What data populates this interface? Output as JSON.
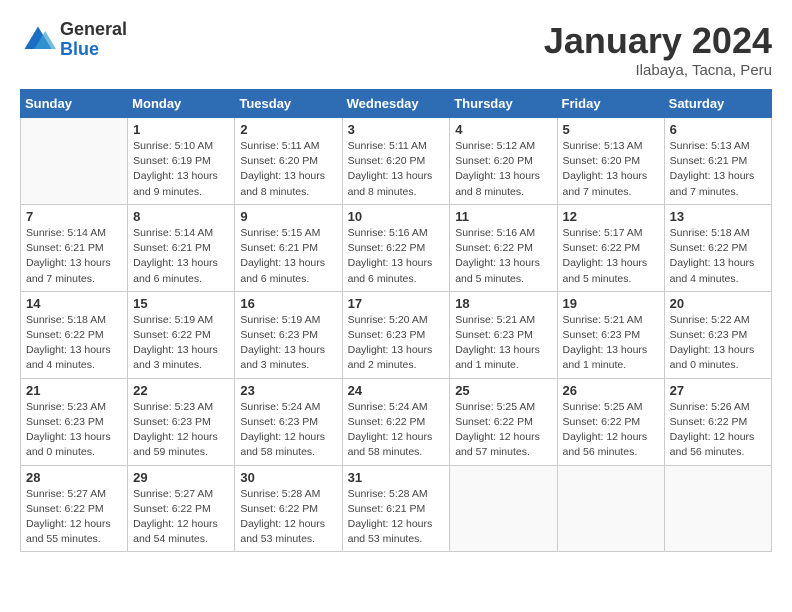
{
  "logo": {
    "general": "General",
    "blue": "Blue"
  },
  "header": {
    "month": "January 2024",
    "location": "Ilabaya, Tacna, Peru"
  },
  "days_of_week": [
    "Sunday",
    "Monday",
    "Tuesday",
    "Wednesday",
    "Thursday",
    "Friday",
    "Saturday"
  ],
  "weeks": [
    [
      {
        "day": "",
        "info": ""
      },
      {
        "day": "1",
        "info": "Sunrise: 5:10 AM\nSunset: 6:19 PM\nDaylight: 13 hours\nand 9 minutes."
      },
      {
        "day": "2",
        "info": "Sunrise: 5:11 AM\nSunset: 6:20 PM\nDaylight: 13 hours\nand 8 minutes."
      },
      {
        "day": "3",
        "info": "Sunrise: 5:11 AM\nSunset: 6:20 PM\nDaylight: 13 hours\nand 8 minutes."
      },
      {
        "day": "4",
        "info": "Sunrise: 5:12 AM\nSunset: 6:20 PM\nDaylight: 13 hours\nand 8 minutes."
      },
      {
        "day": "5",
        "info": "Sunrise: 5:13 AM\nSunset: 6:20 PM\nDaylight: 13 hours\nand 7 minutes."
      },
      {
        "day": "6",
        "info": "Sunrise: 5:13 AM\nSunset: 6:21 PM\nDaylight: 13 hours\nand 7 minutes."
      }
    ],
    [
      {
        "day": "7",
        "info": "Sunrise: 5:14 AM\nSunset: 6:21 PM\nDaylight: 13 hours\nand 7 minutes."
      },
      {
        "day": "8",
        "info": "Sunrise: 5:14 AM\nSunset: 6:21 PM\nDaylight: 13 hours\nand 6 minutes."
      },
      {
        "day": "9",
        "info": "Sunrise: 5:15 AM\nSunset: 6:21 PM\nDaylight: 13 hours\nand 6 minutes."
      },
      {
        "day": "10",
        "info": "Sunrise: 5:16 AM\nSunset: 6:22 PM\nDaylight: 13 hours\nand 6 minutes."
      },
      {
        "day": "11",
        "info": "Sunrise: 5:16 AM\nSunset: 6:22 PM\nDaylight: 13 hours\nand 5 minutes."
      },
      {
        "day": "12",
        "info": "Sunrise: 5:17 AM\nSunset: 6:22 PM\nDaylight: 13 hours\nand 5 minutes."
      },
      {
        "day": "13",
        "info": "Sunrise: 5:18 AM\nSunset: 6:22 PM\nDaylight: 13 hours\nand 4 minutes."
      }
    ],
    [
      {
        "day": "14",
        "info": "Sunrise: 5:18 AM\nSunset: 6:22 PM\nDaylight: 13 hours\nand 4 minutes."
      },
      {
        "day": "15",
        "info": "Sunrise: 5:19 AM\nSunset: 6:22 PM\nDaylight: 13 hours\nand 3 minutes."
      },
      {
        "day": "16",
        "info": "Sunrise: 5:19 AM\nSunset: 6:23 PM\nDaylight: 13 hours\nand 3 minutes."
      },
      {
        "day": "17",
        "info": "Sunrise: 5:20 AM\nSunset: 6:23 PM\nDaylight: 13 hours\nand 2 minutes."
      },
      {
        "day": "18",
        "info": "Sunrise: 5:21 AM\nSunset: 6:23 PM\nDaylight: 13 hours\nand 1 minute."
      },
      {
        "day": "19",
        "info": "Sunrise: 5:21 AM\nSunset: 6:23 PM\nDaylight: 13 hours\nand 1 minute."
      },
      {
        "day": "20",
        "info": "Sunrise: 5:22 AM\nSunset: 6:23 PM\nDaylight: 13 hours\nand 0 minutes."
      }
    ],
    [
      {
        "day": "21",
        "info": "Sunrise: 5:23 AM\nSunset: 6:23 PM\nDaylight: 13 hours\nand 0 minutes."
      },
      {
        "day": "22",
        "info": "Sunrise: 5:23 AM\nSunset: 6:23 PM\nDaylight: 12 hours\nand 59 minutes."
      },
      {
        "day": "23",
        "info": "Sunrise: 5:24 AM\nSunset: 6:23 PM\nDaylight: 12 hours\nand 58 minutes."
      },
      {
        "day": "24",
        "info": "Sunrise: 5:24 AM\nSunset: 6:22 PM\nDaylight: 12 hours\nand 58 minutes."
      },
      {
        "day": "25",
        "info": "Sunrise: 5:25 AM\nSunset: 6:22 PM\nDaylight: 12 hours\nand 57 minutes."
      },
      {
        "day": "26",
        "info": "Sunrise: 5:25 AM\nSunset: 6:22 PM\nDaylight: 12 hours\nand 56 minutes."
      },
      {
        "day": "27",
        "info": "Sunrise: 5:26 AM\nSunset: 6:22 PM\nDaylight: 12 hours\nand 56 minutes."
      }
    ],
    [
      {
        "day": "28",
        "info": "Sunrise: 5:27 AM\nSunset: 6:22 PM\nDaylight: 12 hours\nand 55 minutes."
      },
      {
        "day": "29",
        "info": "Sunrise: 5:27 AM\nSunset: 6:22 PM\nDaylight: 12 hours\nand 54 minutes."
      },
      {
        "day": "30",
        "info": "Sunrise: 5:28 AM\nSunset: 6:22 PM\nDaylight: 12 hours\nand 53 minutes."
      },
      {
        "day": "31",
        "info": "Sunrise: 5:28 AM\nSunset: 6:21 PM\nDaylight: 12 hours\nand 53 minutes."
      },
      {
        "day": "",
        "info": ""
      },
      {
        "day": "",
        "info": ""
      },
      {
        "day": "",
        "info": ""
      }
    ]
  ]
}
